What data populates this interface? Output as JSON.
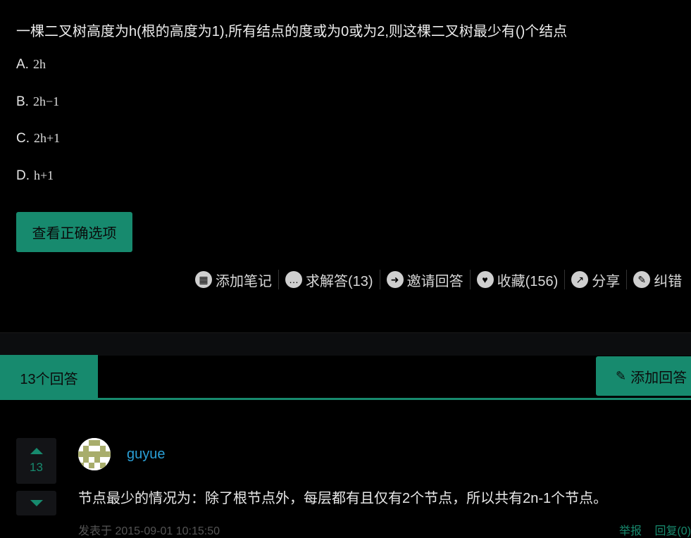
{
  "question": {
    "text": "一棵二叉树高度为h(根的高度为1),所有结点的度或为0或为2,则这棵二叉树最少有()个结点",
    "options": [
      {
        "letter": "A.",
        "text": "2h"
      },
      {
        "letter": "B.",
        "text": "2h−1"
      },
      {
        "letter": "C.",
        "text": "2h+1"
      },
      {
        "letter": "D.",
        "text": "h+1"
      }
    ],
    "check_button": "查看正确选项"
  },
  "actions": [
    {
      "icon": "book-icon",
      "glyph": "▦",
      "label": "添加笔记"
    },
    {
      "icon": "chat-bubble-icon",
      "glyph": "…",
      "label": "求解答(13)"
    },
    {
      "icon": "invite-icon",
      "glyph": "➜",
      "label": "邀请回答"
    },
    {
      "icon": "heart-icon",
      "glyph": "♥",
      "label": "收藏(156)"
    },
    {
      "icon": "share-icon",
      "glyph": "↗",
      "label": "分享"
    },
    {
      "icon": "pencil-icon",
      "glyph": "✎",
      "label": "纠错"
    }
  ],
  "answers_header": {
    "count_label": "13个回答",
    "add_answer_label": "添加回答"
  },
  "answer": {
    "votes": "13",
    "username": "guyue",
    "text": "节点最少的情况为：除了根节点外，每层都有且仅有2个节点，所以共有2n-1个节点。",
    "meta": "发表于 2015-09-01 10:15:50",
    "links": [
      "举报",
      "回复(0)"
    ]
  },
  "colors": {
    "accent": "#178a6e",
    "link": "#2a9fd6",
    "background": "#000000"
  }
}
